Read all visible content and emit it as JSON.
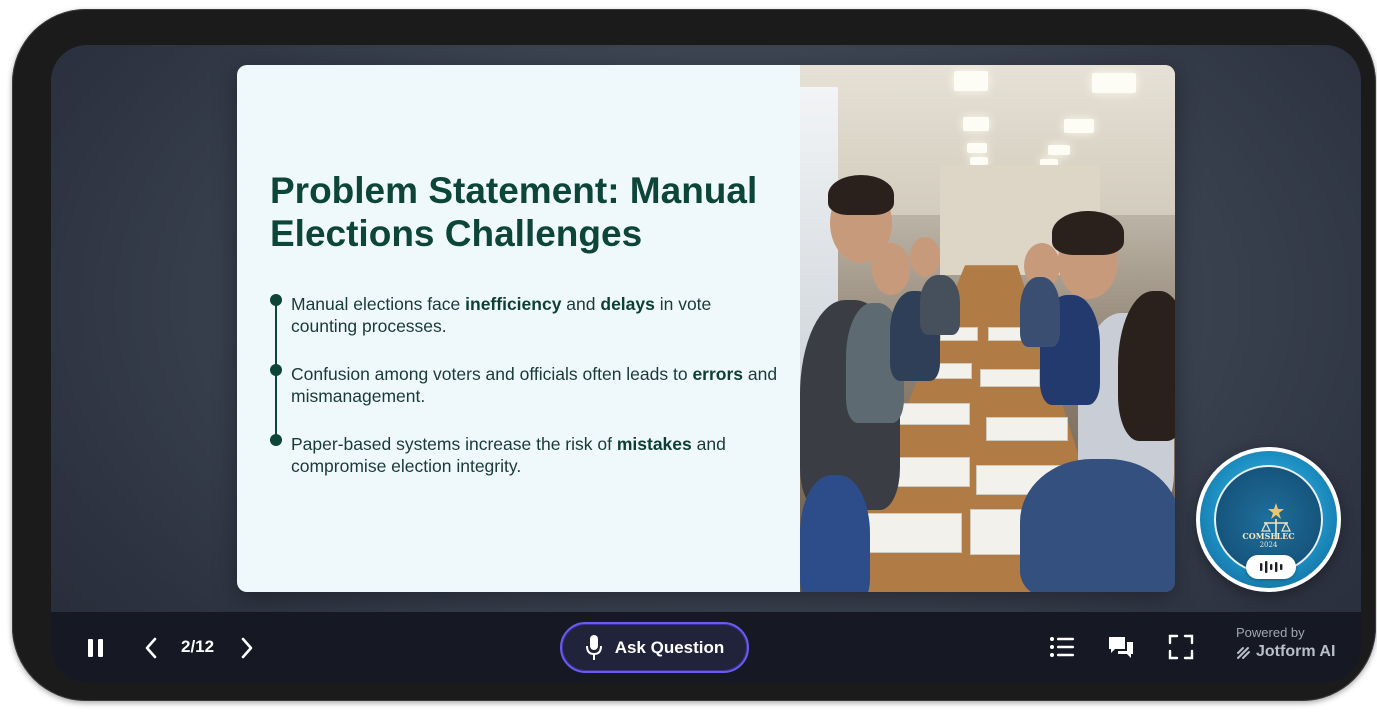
{
  "slide": {
    "title": "Problem Statement: Manual Elections Challenges",
    "bullets": [
      {
        "segments": [
          {
            "text": "Manual elections face ",
            "bold": false
          },
          {
            "text": "inefficiency",
            "bold": true
          },
          {
            "text": " and ",
            "bold": false
          },
          {
            "text": "delays",
            "bold": true
          },
          {
            "text": " in vote counting processes.",
            "bold": false
          }
        ]
      },
      {
        "segments": [
          {
            "text": "Confusion among voters and officials often leads to ",
            "bold": false
          },
          {
            "text": "errors",
            "bold": true
          },
          {
            "text": " and mismanagement.",
            "bold": false
          }
        ]
      },
      {
        "segments": [
          {
            "text": "Paper-based systems increase the risk of ",
            "bold": false
          },
          {
            "text": "mistakes",
            "bold": true
          },
          {
            "text": " and compromise election integrity.",
            "bold": false
          }
        ]
      }
    ],
    "image_icon": "vote-counting-photo",
    "colors": {
      "title": "#0d4638",
      "panel_bg": "#eff9fc"
    }
  },
  "badge": {
    "seal_text": "COMSELEC",
    "seal_year": "2024",
    "icon": "audio-wave-icon",
    "color": "#1d8fc2"
  },
  "controls": {
    "pause_icon": "pause-icon",
    "prev_icon": "chevron-left-icon",
    "next_icon": "chevron-right-icon",
    "page_indicator": "2/12",
    "ask_button_label": "Ask Question",
    "ask_icon": "microphone-icon",
    "list_icon": "list-icon",
    "chat_icon": "chat-icon",
    "fullscreen_icon": "fullscreen-icon",
    "powered_by": "Powered by",
    "brand": "Jotform AI",
    "accent": "#6a5cf0"
  }
}
